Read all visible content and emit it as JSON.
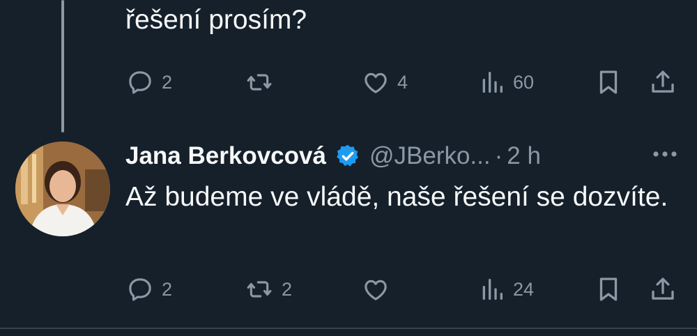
{
  "previous_tweet": {
    "text_tail": "řešení prosím?",
    "replies": "2",
    "retweets": "",
    "likes": "4",
    "views": "60"
  },
  "reply_tweet": {
    "author_name": "Jana Berkovcová",
    "verified": true,
    "handle": "@JBerko...",
    "separator": "·",
    "time": "2 h",
    "text": "Až budeme ve vládě, naše řešení se dozvíte.",
    "replies": "2",
    "retweets": "2",
    "likes": "",
    "views": "24"
  },
  "colors": {
    "background": "#15202b",
    "text": "#f7f9f9",
    "muted": "#8b98a5",
    "verified": "#1d9bf0"
  },
  "icons": [
    "reply-icon",
    "retweet-icon",
    "like-icon",
    "views-icon",
    "bookmark-icon",
    "share-icon",
    "more-icon",
    "verified-badge-icon"
  ]
}
